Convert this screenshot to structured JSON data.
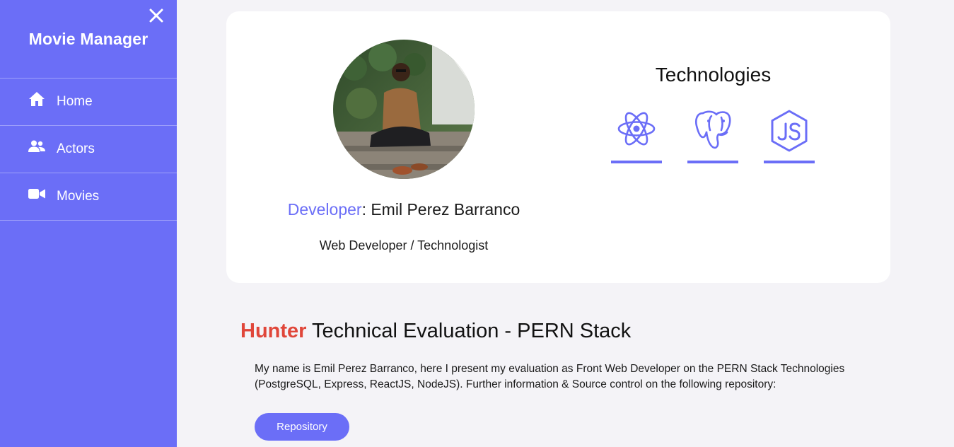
{
  "sidebar": {
    "brand": "Movie Manager",
    "close_icon": "close-icon",
    "items": [
      {
        "label": "Home",
        "icon": "home-icon"
      },
      {
        "label": "Actors",
        "icon": "users-icon"
      },
      {
        "label": "Movies",
        "icon": "video-camera-icon"
      }
    ]
  },
  "profile": {
    "developer_key": "Developer",
    "developer_sep": ": ",
    "developer_name": "Emil Perez Barranco",
    "role": "Web Developer / Technologist",
    "avatar": "developer-photo"
  },
  "technologies": {
    "title": "Technologies",
    "items": [
      {
        "icon": "react-icon"
      },
      {
        "icon": "postgresql-icon"
      },
      {
        "icon": "nodejs-icon"
      }
    ]
  },
  "section": {
    "title_accent": "Hunter",
    "title_rest": " Technical Evaluation - PERN Stack",
    "description": "My name is Emil Perez Barranco, here I present my evaluation as Front Web Developer on the PERN Stack Technologies (PostgreSQL, Express, ReactJS, NodeJS). Further information & Source control on the following repository:",
    "button_label": "Repository"
  },
  "colors": {
    "accent": "#6b6ef7",
    "brand_red": "#e0463a",
    "background": "#f4f3f7"
  }
}
